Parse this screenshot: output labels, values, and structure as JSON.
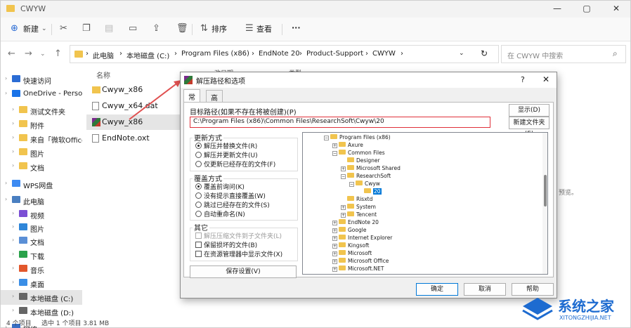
{
  "window": {
    "title": "CWYW"
  },
  "toolbar": {
    "new": "新建",
    "sort": "排序",
    "view": "查看",
    "more": "···"
  },
  "address": {
    "crumbs": [
      "此电脑",
      "本地磁盘 (C:)",
      "Program Files (x86)",
      "EndNote 20",
      "Product-Support",
      "CWYW"
    ],
    "sep": "›",
    "search_placeholder": "在 CWYW 中搜索"
  },
  "sidebar": {
    "items": [
      {
        "label": "快速访问",
        "icon": "star-icon",
        "color": "#2b6cd4"
      },
      {
        "label": "OneDrive - Personal",
        "icon": "cloud-icon",
        "color": "#1a73e8"
      },
      {
        "label": "测试文件夹",
        "icon": "folder-icon",
        "color": "#f1c44e"
      },
      {
        "label": "附件",
        "icon": "folder-icon",
        "color": "#f1c44e"
      },
      {
        "label": "来自「微软Office文档」",
        "icon": "folder-icon",
        "color": "#f1c44e"
      },
      {
        "label": "图片",
        "icon": "folder-icon",
        "color": "#f1c44e"
      },
      {
        "label": "文档",
        "icon": "folder-icon",
        "color": "#f1c44e"
      },
      {
        "label": "WPS网盘",
        "icon": "cloud-icon",
        "color": "#3d8bf2"
      },
      {
        "label": "此电脑",
        "icon": "computer-icon",
        "color": "#4a7fc1"
      },
      {
        "label": "视频",
        "icon": "video-icon",
        "color": "#7b4fd4"
      },
      {
        "label": "图片",
        "icon": "picture-icon",
        "color": "#2f86d9"
      },
      {
        "label": "文档",
        "icon": "document-icon",
        "color": "#5a8fd6"
      },
      {
        "label": "下载",
        "icon": "download-icon",
        "color": "#2aa24a"
      },
      {
        "label": "音乐",
        "icon": "music-icon",
        "color": "#e2572c"
      },
      {
        "label": "桌面",
        "icon": "desktop-icon",
        "color": "#3a8ee6"
      },
      {
        "label": "本地磁盘 (C:)",
        "icon": "drive-icon",
        "color": "#666666"
      },
      {
        "label": "本地磁盘 (D:)",
        "icon": "drive-icon",
        "color": "#666666"
      },
      {
        "label": "网络",
        "icon": "network-icon",
        "color": "#3a6fc4"
      }
    ]
  },
  "files": {
    "column_name": "名称",
    "items": [
      {
        "name": "Cwyw_x86",
        "icon": "folder-icon"
      },
      {
        "name": "Cwyw_x64.dat",
        "icon": "file-icon"
      },
      {
        "name": "Cwyw_x86",
        "icon": "winrar-icon"
      },
      {
        "name": "EndNote.oxt",
        "icon": "file-icon"
      }
    ],
    "hidden_col_fragment": "改日期",
    "hidden_col_fragment2": "类型",
    "side_note": "预览。"
  },
  "status": {
    "count": "4 个项目",
    "selected": "选中 1 个项目  3.81 MB"
  },
  "dialog": {
    "title": "解压路径和选项",
    "help": "?",
    "close": "✕",
    "tabs": [
      "常规",
      "高级"
    ],
    "target_label": "目标路径(如果不存在将被创建)(P)",
    "target_path": "C:\\Program Files (x86)\\Common Files\\ResearchSoft\\Cwyw\\20",
    "show_button": "显示(D)",
    "new_folder_button": "新建文件夹(E)",
    "update_title": "更新方式",
    "update_options": [
      "解压并替换文件(R)",
      "解压并更新文件(U)",
      "仅更新已经存在的文件(F)"
    ],
    "overwrite_title": "覆盖方式",
    "overwrite_options": [
      "覆盖前询问(K)",
      "没有提示直接覆盖(W)",
      "跳过已经存在的文件(S)",
      "自动重命名(N)"
    ],
    "other_title": "其它",
    "other_options": [
      "解压压缩文件到子文件夹(L)",
      "保留损坏的文件(B)",
      "在资源管理器中显示文件(X)"
    ],
    "save_settings": "保存设置(V)",
    "ok": "确定",
    "cancel": "取消",
    "help_button": "帮助",
    "tree": [
      {
        "label": "Program Files (x86)",
        "level": 0,
        "exp": "−"
      },
      {
        "label": "Axure",
        "level": 1,
        "exp": "+"
      },
      {
        "label": "Common Files",
        "level": 1,
        "exp": "−"
      },
      {
        "label": "Designer",
        "level": 2,
        "exp": ""
      },
      {
        "label": "Microsoft Shared",
        "level": 2,
        "exp": "+"
      },
      {
        "label": "ResearchSoft",
        "level": 2,
        "exp": "−"
      },
      {
        "label": "Cwyw",
        "level": 3,
        "exp": "−"
      },
      {
        "label": "20",
        "level": 4,
        "exp": "",
        "selected": true
      },
      {
        "label": "Risxtd",
        "level": 2,
        "exp": ""
      },
      {
        "label": "System",
        "level": 2,
        "exp": "+"
      },
      {
        "label": "Tencent",
        "level": 2,
        "exp": "+"
      },
      {
        "label": "EndNote 20",
        "level": 1,
        "exp": "+"
      },
      {
        "label": "Google",
        "level": 1,
        "exp": "+"
      },
      {
        "label": "Internet Explorer",
        "level": 1,
        "exp": "+"
      },
      {
        "label": "Kingsoft",
        "level": 1,
        "exp": "+"
      },
      {
        "label": "Microsoft",
        "level": 1,
        "exp": "+"
      },
      {
        "label": "Microsoft Office",
        "level": 1,
        "exp": "+"
      },
      {
        "label": "Microsoft.NET",
        "level": 1,
        "exp": "+"
      }
    ]
  },
  "watermark": {
    "text": "系统之家",
    "sub": "XITONGZHIJIA.NET"
  },
  "colors": {
    "accent": "#0078d7",
    "highlight_border": "#e0303a",
    "arrow": "#e05050"
  }
}
